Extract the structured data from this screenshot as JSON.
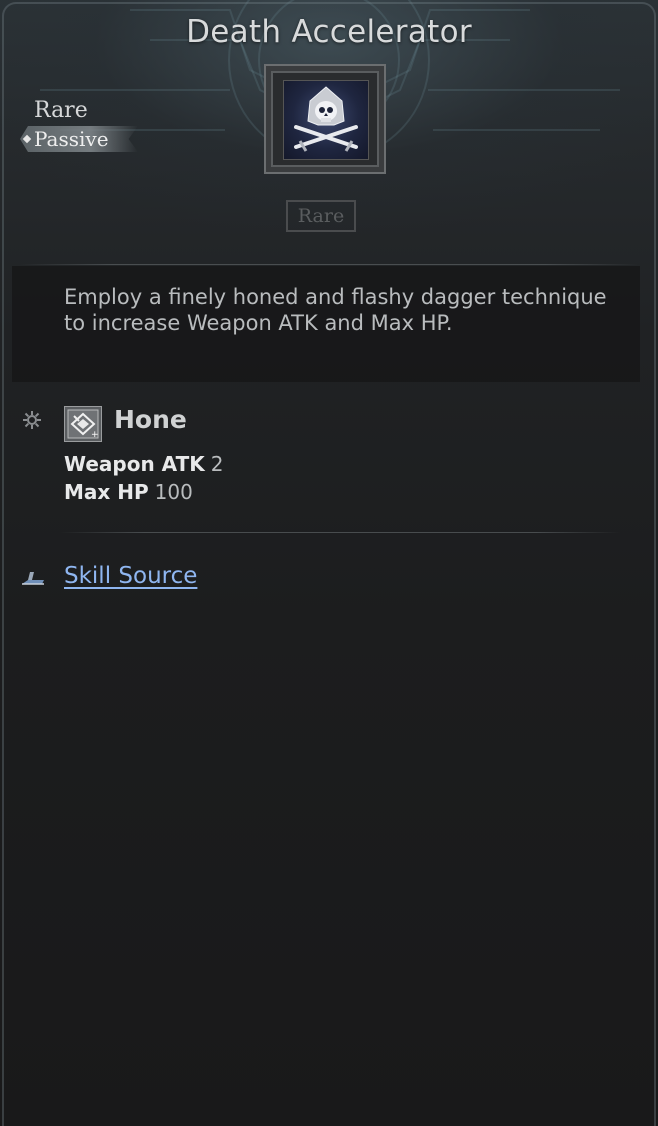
{
  "skill": {
    "title": "Death Accelerator",
    "rarity": "Rare",
    "type_tag": "Passive",
    "rarity_box": "Rare",
    "icon": "skull-crossed-daggers-icon",
    "description": "Employ a finely honed and flashy dagger technique to increase Weapon ATK and Max HP."
  },
  "effect": {
    "icon": "hone-icon",
    "bullet_icon": "gear-icon",
    "name": "Hone",
    "stats": [
      {
        "name": "Weapon ATK",
        "value": "2"
      },
      {
        "name": "Max HP",
        "value": "100"
      }
    ]
  },
  "source": {
    "icon": "scroll-icon",
    "label": "Skill Source",
    "link_color": "#8fb6f0"
  }
}
